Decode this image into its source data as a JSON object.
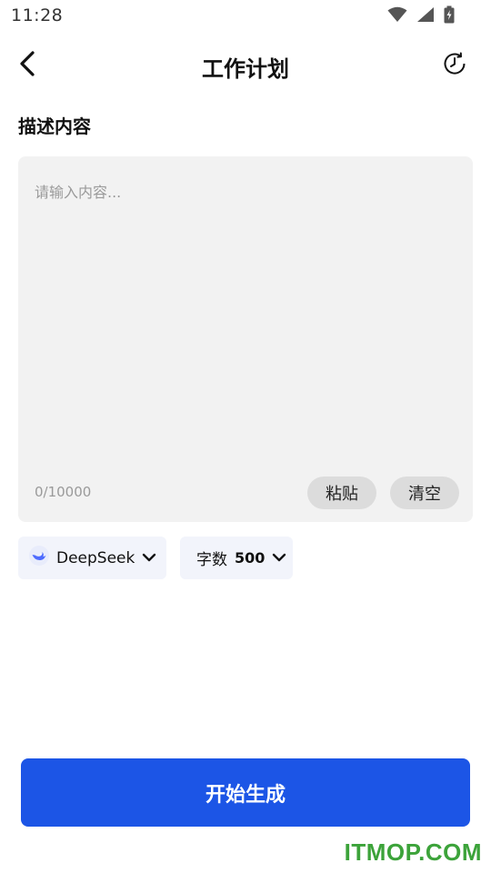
{
  "status_bar": {
    "time": "11:28"
  },
  "header": {
    "title": "工作计划"
  },
  "form": {
    "section_label": "描述内容",
    "input": {
      "placeholder": "请输入内容...",
      "value": ""
    },
    "counter": "0/10000",
    "paste_label": "粘贴",
    "clear_label": "清空"
  },
  "options": {
    "model": {
      "label": "DeepSeek"
    },
    "word_count": {
      "label": "字数",
      "value": "500"
    }
  },
  "actions": {
    "generate_label": "开始生成"
  },
  "watermark": "ITMOP.COM",
  "colors": {
    "primary": "#1c55e6",
    "input_bg": "#f2f2f2",
    "chip_bg": "#f2f4fb",
    "pill_bg": "#dcdcdc",
    "watermark": "#3ca33a"
  },
  "icons": [
    "wifi-icon",
    "signal-icon",
    "battery-icon",
    "back-arrow-icon",
    "history-clock-icon",
    "deepseek-logo-icon",
    "chevron-down-icon"
  ]
}
